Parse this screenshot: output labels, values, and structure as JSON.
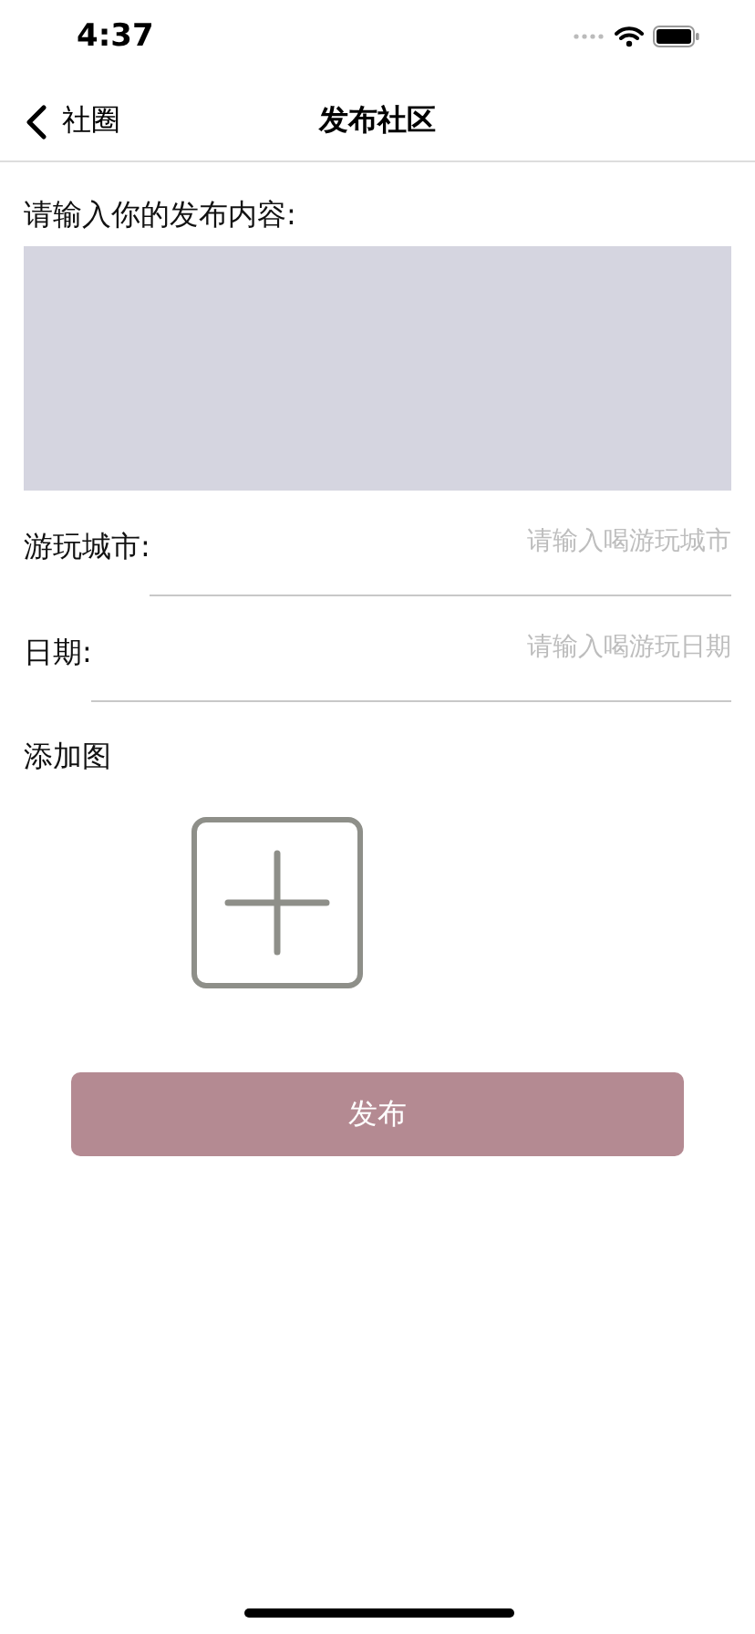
{
  "status_bar": {
    "time": "4:37"
  },
  "nav": {
    "back_label": "社圈",
    "title": "发布社区"
  },
  "content_label": "请输入你的发布内容:",
  "fields": [
    {
      "label": "游玩城市:",
      "placeholder": "请输入喝游玩城市"
    },
    {
      "label": "日期:",
      "placeholder": "请输入喝游玩日期"
    }
  ],
  "image_label": "添加图",
  "submit": "发布"
}
